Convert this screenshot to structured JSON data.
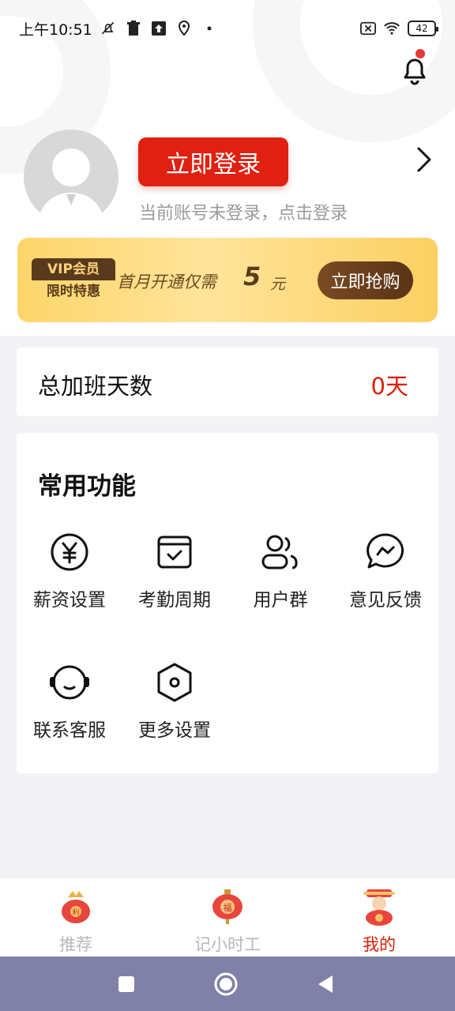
{
  "status_bar": {
    "time": "上午10:51",
    "battery": "42",
    "icons": [
      "notifications-off-icon",
      "trash-icon",
      "upload-icon",
      "location-icon",
      "dot-icon",
      "sim-x-icon",
      "wifi-icon",
      "battery-icon"
    ]
  },
  "header": {
    "bell_icon": "bell-icon",
    "has_unread": true
  },
  "profile": {
    "login_button": "立即登录",
    "hint": "当前账号未登录，点击登录"
  },
  "vip": {
    "badge_top": "VIP会员",
    "badge_bottom": "限时特惠",
    "text": "首月开通仅需",
    "price": "5",
    "unit": "元",
    "button": "立即抢购"
  },
  "overtime": {
    "label": "总加班天数",
    "value": "0天"
  },
  "functions": {
    "title": "常用功能",
    "items": [
      {
        "label": "薪资设置",
        "icon": "yuan-circle-icon"
      },
      {
        "label": "考勤周期",
        "icon": "calendar-check-icon"
      },
      {
        "label": "用户群",
        "icon": "users-icon"
      },
      {
        "label": "意见反馈",
        "icon": "feedback-chat-icon"
      },
      {
        "label": "联系客服",
        "icon": "headset-icon"
      },
      {
        "label": "更多设置",
        "icon": "hexagon-settings-icon"
      }
    ]
  },
  "bottom_nav": {
    "items": [
      {
        "label": "推荐",
        "icon": "fortune-bag-icon",
        "active": false
      },
      {
        "label": "记小时工",
        "icon": "lantern-icon",
        "active": false
      },
      {
        "label": "我的",
        "icon": "fortune-god-icon",
        "active": true
      }
    ]
  },
  "colors": {
    "accent": "#d81e06",
    "login_button": "#e02010",
    "vip_gold": "#fdd56a",
    "vip_brown": "#5a3a1c",
    "system_nav": "#8080a8"
  }
}
